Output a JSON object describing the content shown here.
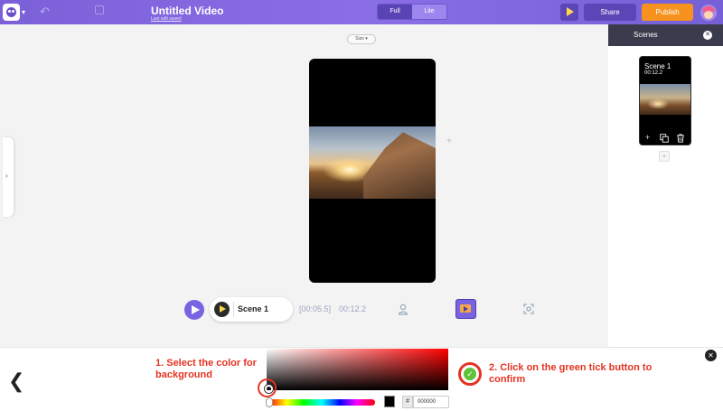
{
  "header": {
    "title": "Untitled Video",
    "subtitle": "Last edit saved",
    "mode_full": "Full",
    "mode_lite": "Lite",
    "share_label": "Share",
    "publish_label": "Publish",
    "colors": {
      "bar": "#7b60d8",
      "publish": "#f7921e",
      "share": "#5b46b8"
    }
  },
  "canvas": {
    "size_label": "Size ▾"
  },
  "playback": {
    "scene_label": "Scene 1",
    "elapsed": "[00:05.5]",
    "total": "00:12.2"
  },
  "scenes_panel": {
    "title": "Scenes",
    "close_glyph": "✕",
    "scenes": [
      {
        "name": "Scene 1",
        "duration": "00:12.2"
      }
    ],
    "add_glyph": "+"
  },
  "color_picker": {
    "back_glyph": "❮",
    "hash": "#",
    "hex_value": "000000",
    "current_color": "#000000",
    "confirm_glyph": "✓",
    "close_glyph": "✕"
  },
  "annotations": {
    "step1": "1. Select the color for background",
    "step2": "2. Click on the green tick button to confirm",
    "accent_color": "#e53322"
  }
}
